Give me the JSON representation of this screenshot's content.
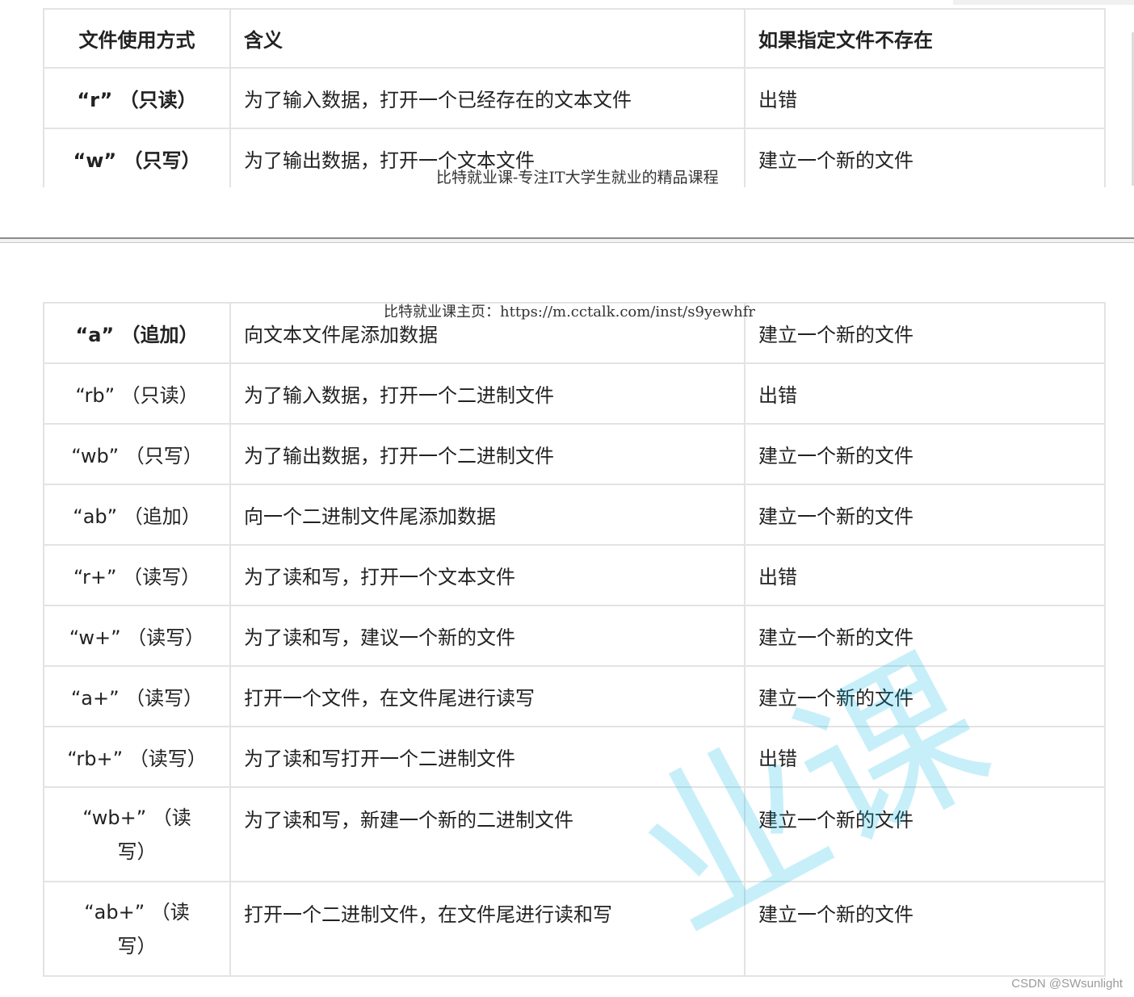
{
  "table1": {
    "header": [
      "文件使用方式",
      "含义",
      "如果指定文件不存在"
    ],
    "rows": [
      [
        "“r” （只读）",
        "为了输入数据，打开一个已经存在的文本文件",
        "出错"
      ],
      [
        "“w” （只写）",
        "为了输出数据，打开一个文本文件",
        "建立一个新的文件"
      ]
    ]
  },
  "table2": {
    "rows": [
      [
        "“a” （追加）",
        "向文本文件尾添加数据",
        "建立一个新的文件"
      ],
      [
        "“rb” （只读）",
        "为了输入数据，打开一个二进制文件",
        "出错"
      ],
      [
        "“wb” （只写）",
        "为了输出数据，打开一个二进制文件",
        "建立一个新的文件"
      ],
      [
        "“ab” （追加）",
        "向一个二进制文件尾添加数据",
        "建立一个新的文件"
      ],
      [
        "“r+” （读写）",
        "为了读和写，打开一个文本文件",
        "出错"
      ],
      [
        "“w+” （读写）",
        "为了读和写，建议一个新的文件",
        "建立一个新的文件"
      ],
      [
        "“a+” （读写）",
        "打开一个文件，在文件尾进行读写",
        "建立一个新的文件"
      ],
      [
        "“rb+” （读写）",
        "为了读和写打开一个二进制文件",
        "出错"
      ],
      [
        "“wb+” （读写）",
        "为了读和写，新建一个新的二进制文件",
        "建立一个新的文件"
      ],
      [
        "“ab+” （读写）",
        "打开一个二进制文件，在文件尾进行读和写",
        "建立一个新的文件"
      ]
    ]
  },
  "watermark": {
    "footer_line": "比特就业课-专注IT大学生就业的精品课程",
    "header_line": "比特就业课主页：https://m.cctalk.com/inst/s9yewhfr",
    "big_text": "业课",
    "big_color": "#00b4e6"
  },
  "credit": "CSDN @SWsunlight"
}
